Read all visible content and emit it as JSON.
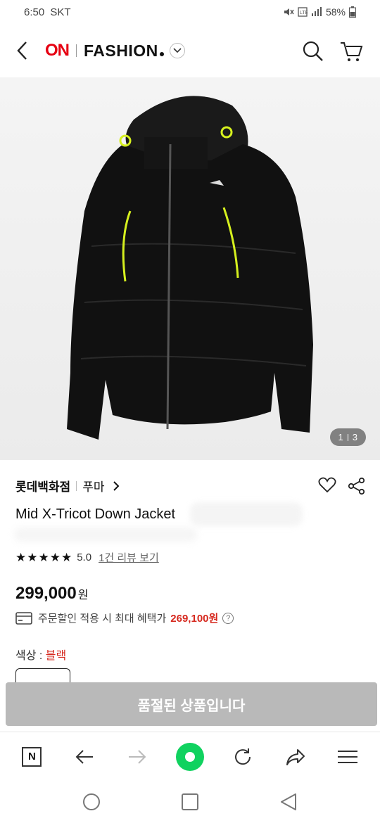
{
  "status_bar": {
    "time": "6:50",
    "carrier": "SKT",
    "battery": "58%"
  },
  "header": {
    "logo_on": "ON",
    "logo_fashion": "FASHION"
  },
  "image": {
    "current": "1",
    "total": "3"
  },
  "product": {
    "brand": "롯데백화점",
    "sub_brand": "푸마",
    "name": "Mid X-Tricot Down Jacket",
    "rating": "5.0",
    "stars": "★★★★★",
    "review_link": "1건 리뷰 보기",
    "price": "299,000",
    "price_unit": "원",
    "benefit_text": "주문할인 적용 시 최대 혜택가",
    "benefit_price": "269,100원",
    "color_label": "색상 : ",
    "color_value": "블랙"
  },
  "soldout_label": "품절된 상품입니다",
  "colors": {
    "brand_red": "#e60012",
    "benefit_red": "#d6281e",
    "soldout_gray": "#b9b9b9",
    "naver_green": "#10d25f"
  }
}
